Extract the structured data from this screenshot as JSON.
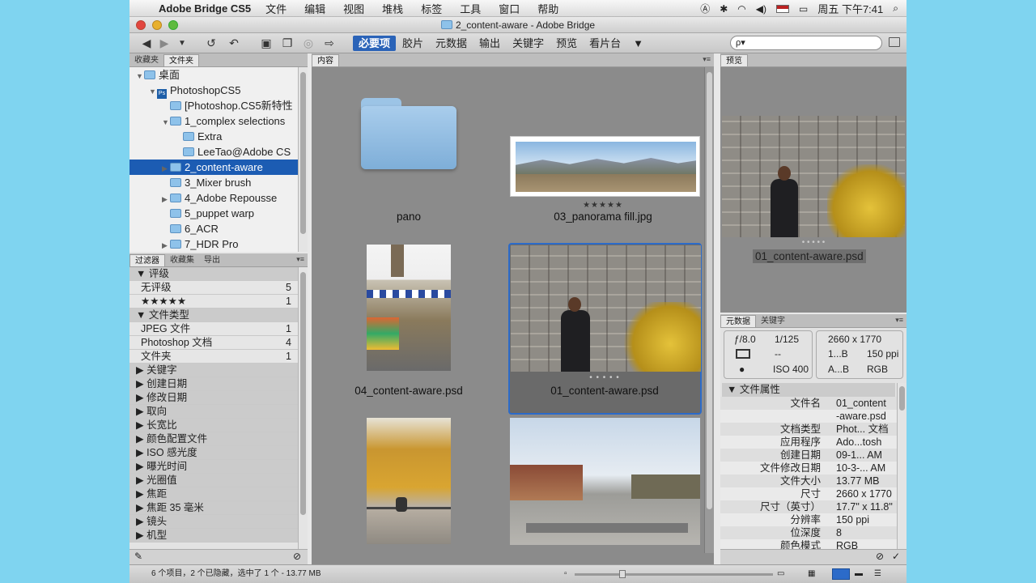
{
  "menubar": {
    "app_name": "Adobe Bridge CS5",
    "items": [
      "文件",
      "编辑",
      "视图",
      "堆栈",
      "标签",
      "工具",
      "窗口",
      "帮助"
    ],
    "clock": "周五 下午7:41"
  },
  "window": {
    "title": "2_content-aware - Adobe Bridge"
  },
  "workspaces": [
    {
      "label": "必要项",
      "active": true
    },
    {
      "label": "胶片",
      "active": false
    },
    {
      "label": "元数据",
      "active": false
    },
    {
      "label": "输出",
      "active": false
    },
    {
      "label": "关键字",
      "active": false
    },
    {
      "label": "预览",
      "active": false
    },
    {
      "label": "看片台",
      "active": false
    }
  ],
  "search": {
    "placeholder": "ρ▾"
  },
  "left_top": {
    "tabs": [
      "收藏夹",
      "文件夹"
    ],
    "tree": [
      {
        "label": "桌面",
        "indent": 0,
        "icon": "folder",
        "tri": "▼",
        "sel": false
      },
      {
        "label": "PhotoshopCS5",
        "indent": 1,
        "icon": "ps",
        "tri": "▼",
        "sel": false
      },
      {
        "label": "[Photoshop.CS5新特性",
        "indent": 2,
        "icon": "folder",
        "tri": "",
        "sel": false
      },
      {
        "label": "1_complex selections",
        "indent": 2,
        "icon": "folder",
        "tri": "▼",
        "sel": false
      },
      {
        "label": "Extra",
        "indent": 3,
        "icon": "folder",
        "tri": "",
        "sel": false
      },
      {
        "label": "LeeTao@Adobe CS",
        "indent": 3,
        "icon": "folder",
        "tri": "",
        "sel": false
      },
      {
        "label": "2_content-aware",
        "indent": 2,
        "icon": "folder",
        "tri": "▶",
        "sel": true
      },
      {
        "label": "3_Mixer brush",
        "indent": 2,
        "icon": "folder",
        "tri": "",
        "sel": false
      },
      {
        "label": "4_Adobe Repousse",
        "indent": 2,
        "icon": "folder",
        "tri": "▶",
        "sel": false
      },
      {
        "label": "5_puppet warp",
        "indent": 2,
        "icon": "folder",
        "tri": "",
        "sel": false
      },
      {
        "label": "6_ACR",
        "indent": 2,
        "icon": "folder",
        "tri": "",
        "sel": false
      },
      {
        "label": "7_HDR Pro",
        "indent": 2,
        "icon": "folder",
        "tri": "▶",
        "sel": false
      }
    ]
  },
  "filter": {
    "tabs": [
      "过滤器",
      "收藏集",
      "导出"
    ],
    "rows": [
      {
        "type": "hdr",
        "label": "▼ 评级",
        "count": ""
      },
      {
        "type": "item",
        "label": "无评级",
        "count": "5"
      },
      {
        "type": "item",
        "label": "★★★★★",
        "count": "1"
      },
      {
        "type": "hdr",
        "label": "▼ 文件类型",
        "count": ""
      },
      {
        "type": "item",
        "label": "JPEG 文件",
        "count": "1"
      },
      {
        "type": "item",
        "label": "Photoshop 文档",
        "count": "4"
      },
      {
        "type": "item",
        "label": "文件夹",
        "count": "1"
      },
      {
        "type": "hdr",
        "label": "▶ 关键字",
        "count": ""
      },
      {
        "type": "hdr",
        "label": "▶ 创建日期",
        "count": ""
      },
      {
        "type": "hdr",
        "label": "▶ 修改日期",
        "count": ""
      },
      {
        "type": "hdr",
        "label": "▶ 取向",
        "count": ""
      },
      {
        "type": "hdr",
        "label": "▶ 长宽比",
        "count": ""
      },
      {
        "type": "hdr",
        "label": "▶ 颜色配置文件",
        "count": ""
      },
      {
        "type": "hdr",
        "label": "▶ ISO 感光度",
        "count": ""
      },
      {
        "type": "hdr",
        "label": "▶ 曝光时间",
        "count": ""
      },
      {
        "type": "hdr",
        "label": "▶ 光圈值",
        "count": ""
      },
      {
        "type": "hdr",
        "label": "▶ 焦距",
        "count": ""
      },
      {
        "type": "hdr",
        "label": "▶ 焦距 35 毫米",
        "count": ""
      },
      {
        "type": "hdr",
        "label": "▶ 镜头",
        "count": ""
      },
      {
        "type": "hdr",
        "label": "▶ 机型",
        "count": ""
      }
    ]
  },
  "content": {
    "tab": "内容",
    "items": [
      {
        "caption": "pano",
        "stars": ""
      },
      {
        "caption": "03_panorama fill.jpg",
        "stars": "★★★★★"
      },
      {
        "caption": "04_content-aware.psd",
        "stars": ""
      },
      {
        "caption": "01_content-aware.psd",
        "stars": "• • • • •"
      }
    ]
  },
  "preview": {
    "tab": "预览",
    "caption": "01_content-aware.psd",
    "dots": "• • • • •"
  },
  "metadata": {
    "tabs": [
      "元数据",
      "关键字"
    ],
    "camera": {
      "aperture": "ƒ/8.0",
      "shutter": "1/125",
      "dash": "--",
      "iso": "ISO 400",
      "dims": "2660 x 1770",
      "size": "1...B",
      "ppi": "150 ppi",
      "profile": "A...B",
      "mode": "RGB"
    },
    "section": "▼ 文件属性",
    "rows": [
      {
        "label": "文件名",
        "value": "01_content"
      },
      {
        "label": "",
        "value": "-aware.psd"
      },
      {
        "label": "文档类型",
        "value": "Phot... 文档"
      },
      {
        "label": "应用程序",
        "value": "Ado...tosh"
      },
      {
        "label": "创建日期",
        "value": "09-1... AM"
      },
      {
        "label": "文件修改日期",
        "value": "10-3-... AM"
      },
      {
        "label": "文件大小",
        "value": "13.77 MB"
      },
      {
        "label": "尺寸",
        "value": "2660 x 1770"
      },
      {
        "label": "尺寸（英寸）",
        "value": "17.7\" x 11.8\""
      },
      {
        "label": "分辨率",
        "value": "150 ppi"
      },
      {
        "label": "位深度",
        "value": "8"
      },
      {
        "label": "颜色模式",
        "value": "RGB"
      }
    ]
  },
  "status": {
    "text": "6 个项目，2 个已隐藏，选中了 1 个 - 13.77 MB"
  }
}
